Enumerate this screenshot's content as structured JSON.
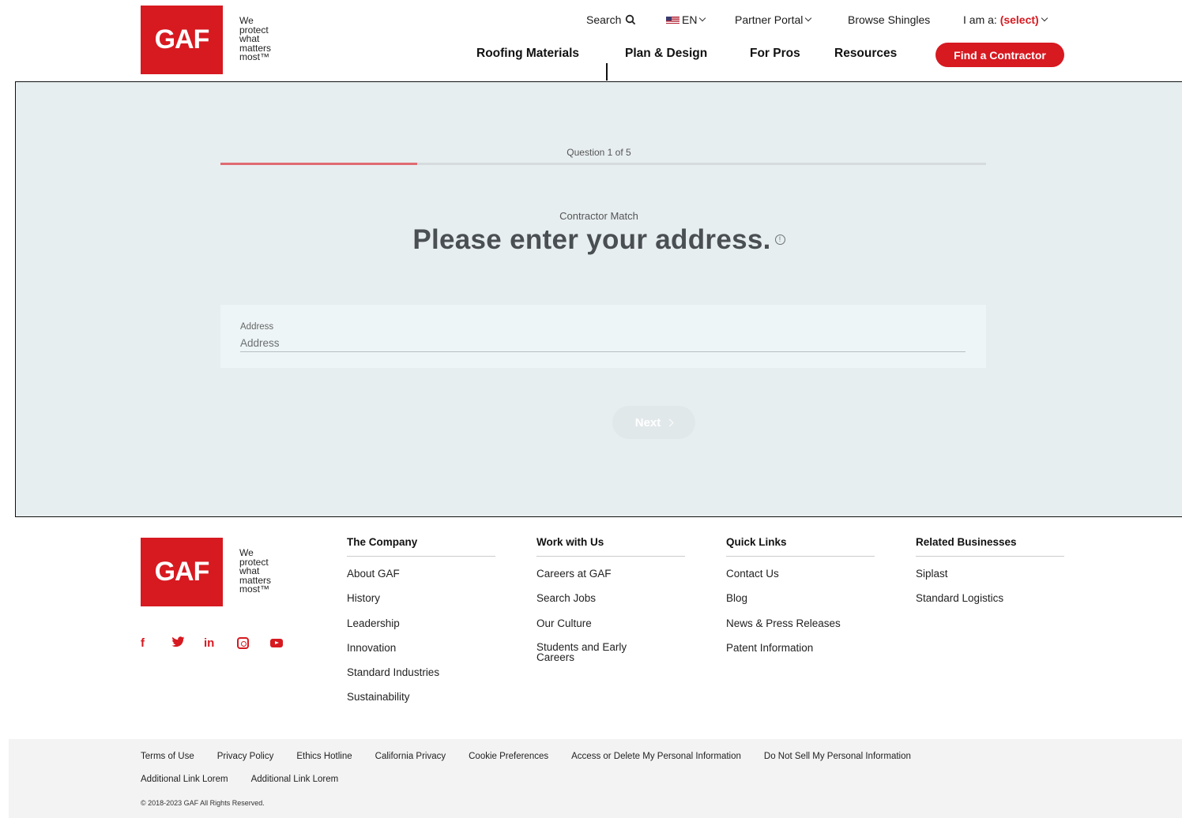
{
  "header": {
    "logo_text": "GAF",
    "tagline": [
      "We",
      "protect",
      "what",
      "matters",
      "most™"
    ],
    "utility": {
      "search": "Search",
      "language": "EN",
      "partner_portal": "Partner Portal",
      "browse_shingles": "Browse Shingles",
      "i_am_a": "I am a:",
      "i_am_a_value": "(select)"
    },
    "nav": [
      "Roofing Materials",
      "Plan & Design",
      "For Pros",
      "Resources"
    ],
    "cta": "Find a Contractor"
  },
  "quiz": {
    "question_count": "Question 1 of 5",
    "progress_fraction": 0.2571,
    "subtitle": "Contractor Match",
    "title": "Please enter your address.",
    "address_label": "Address",
    "address_placeholder": "Address",
    "next_label": "Next"
  },
  "footer": {
    "logo_text": "GAF",
    "tagline": [
      "We",
      "protect",
      "what",
      "matters",
      "most™"
    ],
    "social": [
      "facebook-icon",
      "twitter-icon",
      "linkedin-icon",
      "instagram-icon",
      "youtube-icon"
    ],
    "columns": [
      {
        "title": "The Company",
        "links": [
          "About GAF",
          "History",
          "Leadership",
          "Innovation",
          "Standard Industries",
          "Sustainability"
        ]
      },
      {
        "title": "Work with Us",
        "links": [
          "Careers at GAF",
          "Search Jobs",
          "Our Culture",
          "Students and Early Careers"
        ]
      },
      {
        "title": "Quick Links",
        "links": [
          "Contact Us",
          "Blog",
          "News & Press Releases",
          "Patent Information"
        ]
      },
      {
        "title": "Related Businesses",
        "links": [
          "Siplast",
          "Standard Logistics"
        ]
      }
    ],
    "legal_links": [
      "Terms of Use",
      "Privacy Policy",
      "Ethics Hotline",
      "California Privacy",
      "Cookie Preferences",
      "Access or Delete My Personal Information",
      "Do Not Sell My Personal Information"
    ],
    "legal_links_2": [
      "Additional Link Lorem",
      "Additional Link Lorem"
    ],
    "copyright": "© 2018-2023 GAF All Rights Reserved."
  },
  "colors": {
    "brand_red": "#d71920",
    "progress": "#e06a72",
    "quiz_bg": "#e7eef0"
  }
}
